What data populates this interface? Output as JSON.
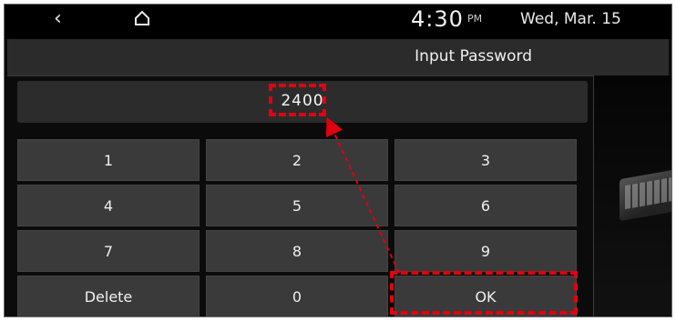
{
  "status_bar": {
    "back_icon": "back-chevron-icon",
    "home_icon": "home-icon",
    "time": "4:30",
    "ampm": "PM",
    "date": "Wed, Mar. 15"
  },
  "header": {
    "title": "Input Password"
  },
  "password_field": {
    "value": "2400"
  },
  "keypad": {
    "keys": [
      "1",
      "2",
      "3",
      "4",
      "5",
      "6",
      "7",
      "8",
      "9",
      "Delete",
      "0",
      "OK"
    ]
  },
  "annotations": {
    "highlight_color": "#e3000f"
  }
}
